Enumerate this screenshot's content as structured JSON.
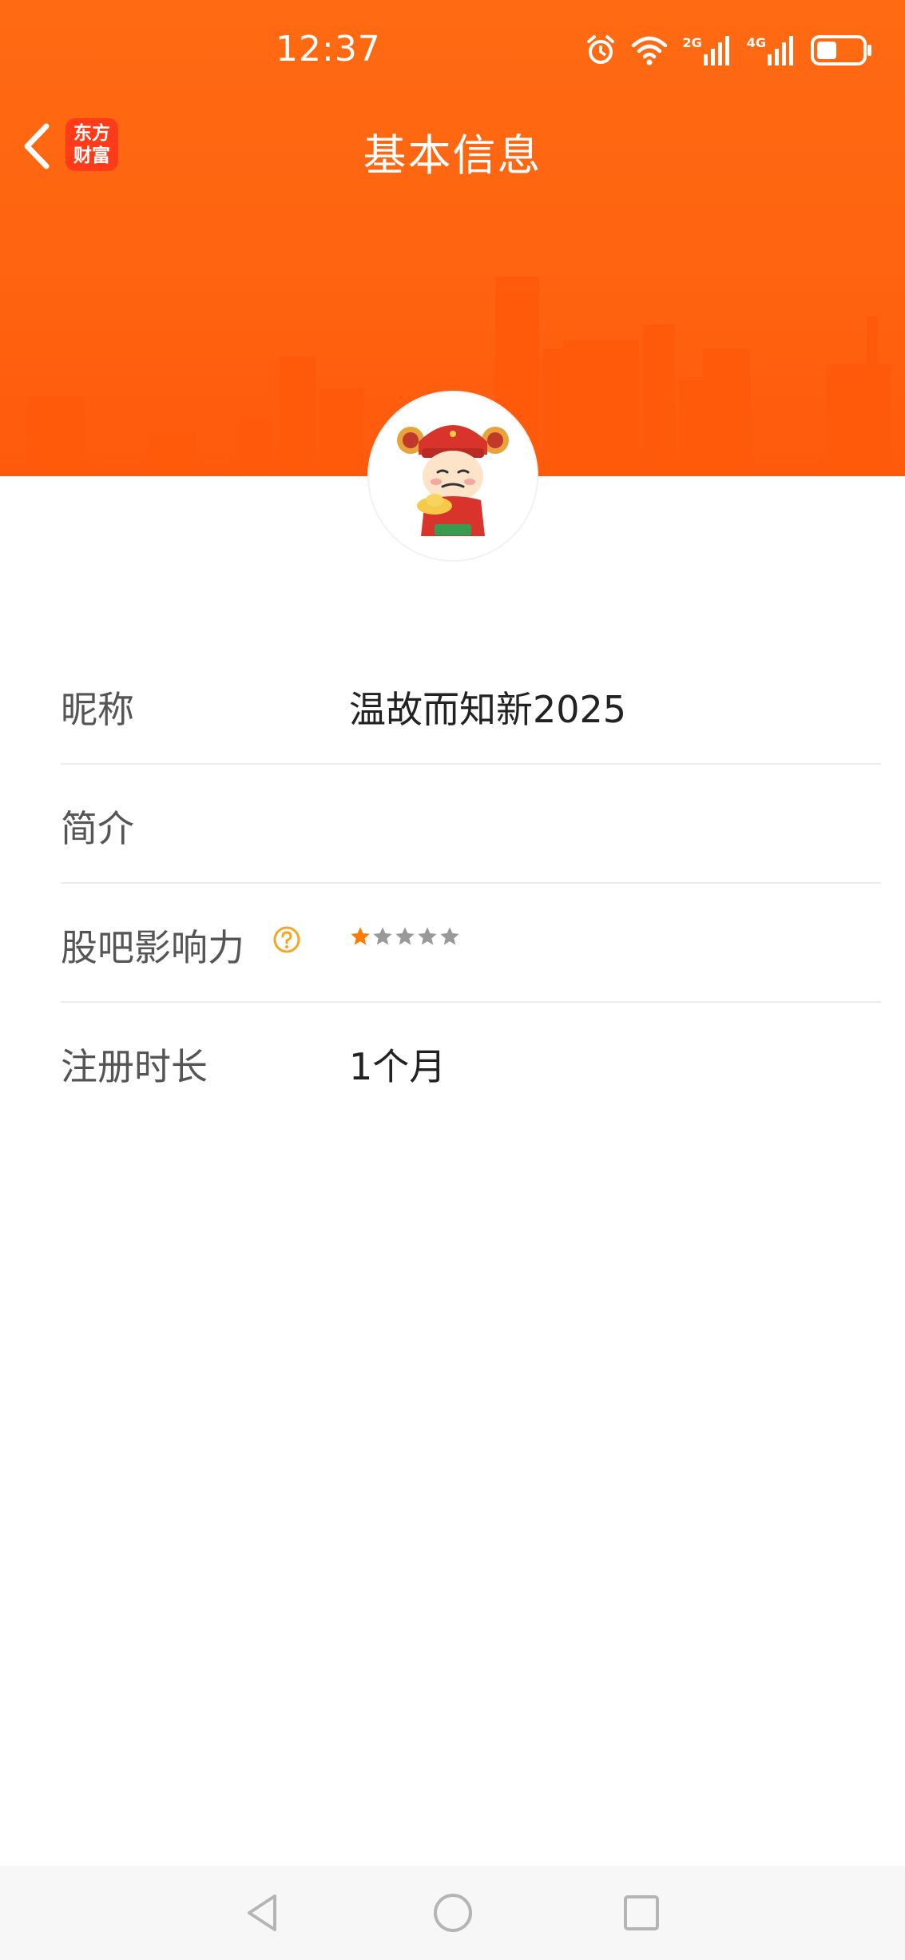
{
  "status_bar": {
    "time": "12:37",
    "icons": [
      "alarm-icon",
      "wifi-icon",
      "signal-2g-icon",
      "signal-4g-icon",
      "battery-icon"
    ],
    "signal_labels": [
      "2G",
      "4G"
    ]
  },
  "nav": {
    "title": "基本信息",
    "logo_line1": "东方",
    "logo_line2": "财富"
  },
  "profile": {
    "rows": [
      {
        "label": "昵称",
        "value": "温故而知新2025"
      },
      {
        "label": "简介",
        "value": ""
      },
      {
        "label": "股吧影响力",
        "rating": 1,
        "max_rating": 5
      },
      {
        "label": "注册时长",
        "value": "1个月"
      }
    ]
  },
  "colors": {
    "brand": "#ff6a12",
    "star_active": "#ff7a00",
    "star_inactive": "#999999",
    "help_icon": "#f5a623"
  }
}
